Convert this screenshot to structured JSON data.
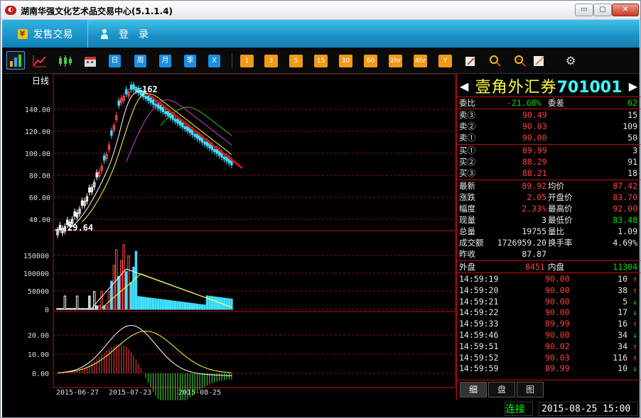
{
  "window": {
    "title": "湖南华强文化艺术品交易中心(5.1.1.4)",
    "app_icon": "logo-icon",
    "min": "▭",
    "max": "▢",
    "close": "✕"
  },
  "menu": {
    "sell_label": "发售交易",
    "login_label": "登　录"
  },
  "toolbar": {
    "periods": [
      "日",
      "周",
      "月",
      "季",
      "X"
    ],
    "minutes": [
      "1",
      "3",
      "5",
      "15",
      "30",
      "60",
      "2hr",
      "4hr",
      "Y"
    ]
  },
  "chart": {
    "period_label": "日线",
    "price_axis": [
      "140.00",
      "120.00",
      "100.00",
      "80.00",
      "60.00",
      "40.00"
    ],
    "volume_axis": [
      "150000",
      "100000",
      "50000",
      "0"
    ],
    "macd_axis": [
      "20.00",
      "10.00",
      "0.00"
    ],
    "high_label": "162",
    "low_label": "29.64",
    "dates": [
      "2015-06-27",
      "2015-07-23",
      "2015-08-25"
    ]
  },
  "chart_data": {
    "type": "candlestick",
    "title": "日线",
    "price_ylabels": [
      140,
      120,
      100,
      80,
      60,
      40
    ],
    "annotated_high": 162,
    "annotated_low": 29.64,
    "x_dates": [
      "2015-06-27",
      "2015-07-23",
      "2015-08-25"
    ],
    "volume_ylabels": [
      150000,
      100000,
      50000,
      0
    ],
    "macd_ylabels": [
      20,
      10,
      0
    ]
  },
  "stock": {
    "name": "壹角外汇券",
    "code": "701001",
    "left_arrow": "◀",
    "right_arrow": "▶"
  },
  "ratio": {
    "label": "委比",
    "value": "-21.68%",
    "diff_label": "委差",
    "diff": "62"
  },
  "asks": [
    {
      "label": "卖③",
      "price": "90.49",
      "vol": "15"
    },
    {
      "label": "卖②",
      "price": "90.03",
      "vol": "109"
    },
    {
      "label": "卖①",
      "price": "90.00",
      "vol": "50"
    }
  ],
  "bids": [
    {
      "label": "买①",
      "price": "89.99",
      "vol": "3"
    },
    {
      "label": "买②",
      "price": "88.29",
      "vol": "91"
    },
    {
      "label": "买③",
      "price": "88.21",
      "vol": "18"
    }
  ],
  "quote": [
    {
      "l1": "最新",
      "v1": "89.92",
      "l2": "均价",
      "v2": "87.42"
    },
    {
      "l1": "涨跌",
      "v1": "2.05",
      "l2": "开盘价",
      "v2": "83.70"
    },
    {
      "l1": "幅度",
      "v1": "2.33%",
      "l2": "最高价",
      "v2": "92.00"
    },
    {
      "l1": "现量",
      "v1": "3",
      "l2": "最低价",
      "v2": "83.48"
    },
    {
      "l1": "总量",
      "v1": "19755",
      "l2": "量比",
      "v2": "1.09"
    },
    {
      "l1": "成交额",
      "v1": "1726959.20",
      "l2": "换手率",
      "v2": "4.69%"
    },
    {
      "l1": "昨收",
      "v1": "87.87",
      "l2": "",
      "v2": ""
    }
  ],
  "outer": {
    "label": "外盘",
    "value": "8451",
    "inner_label": "内盘",
    "inner_value": "11304"
  },
  "ticks": [
    {
      "time": "14:59:19",
      "price": "90.00",
      "vol": "10",
      "dir": "↑"
    },
    {
      "time": "14:59:20",
      "price": "90.00",
      "vol": "38",
      "dir": "↑"
    },
    {
      "time": "14:59:21",
      "price": "90.00",
      "vol": "5",
      "dir": "↓"
    },
    {
      "time": "14:59:22",
      "price": "90.00",
      "vol": "17",
      "dir": "↓"
    },
    {
      "time": "14:59:33",
      "price": "89.99",
      "vol": "16",
      "dir": "↑"
    },
    {
      "time": "14:59:46",
      "price": "90.00",
      "vol": "34",
      "dir": "↓"
    },
    {
      "time": "14:59:51",
      "price": "90.02",
      "vol": "34",
      "dir": "↑"
    },
    {
      "time": "14:59:52",
      "price": "90.03",
      "vol": "116",
      "dir": "↑"
    },
    {
      "time": "14:59:59",
      "price": "89.99",
      "vol": "10",
      "dir": "↓"
    }
  ],
  "tabs": [
    "细",
    "盘",
    "图"
  ],
  "status": {
    "connection": "连接",
    "datetime": "2015-08-25 15:00"
  },
  "colors": {
    "up": "#ff4040",
    "down": "#40ffff",
    "trendline": "#e01010",
    "accent": "#1a8fc4"
  }
}
